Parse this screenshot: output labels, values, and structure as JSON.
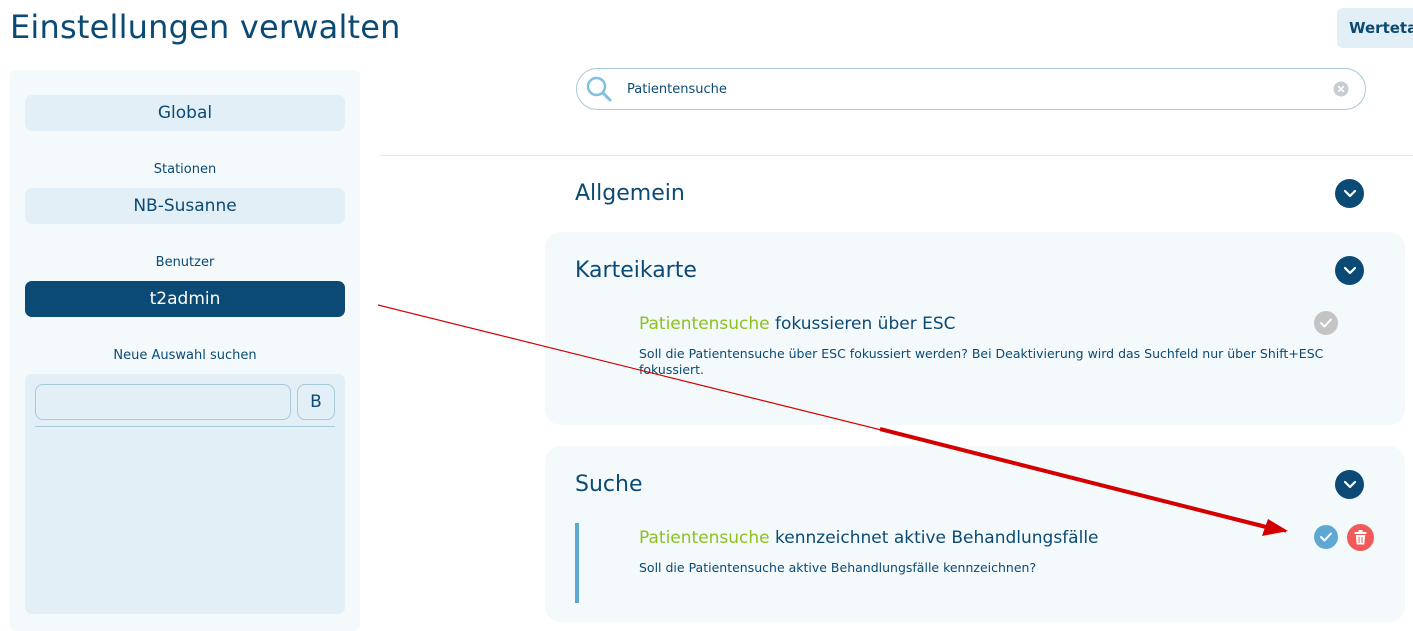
{
  "page": {
    "title": "Einstellungen verwalten",
    "top_right_button": "Wertetal"
  },
  "sidebar": {
    "global_button": "Global",
    "stationen_label": "Stationen",
    "station_button": "NB-Susanne",
    "benutzer_label": "Benutzer",
    "user_button": "t2admin",
    "neue_auswahl_label": "Neue Auswahl suchen",
    "search_input_value": "",
    "search_button": "B"
  },
  "search": {
    "value": "Patientensuche"
  },
  "sections": {
    "allgemein": {
      "title": "Allgemein"
    },
    "karteikarte": {
      "title": "Karteikarte",
      "setting": {
        "title_highlight": "Patientensuche",
        "title_rest": " fokussieren über ESC",
        "description": "Soll die Patientensuche über ESC fokussiert werden? Bei Deaktivierung wird das Suchfeld nur über Shift+ESC fokussiert."
      }
    },
    "suche": {
      "title": "Suche",
      "setting": {
        "title_highlight": "Patientensuche",
        "title_rest": " kennzeichnet aktive Behandlungsfälle",
        "description": "Soll die Patientensuche aktive Behandlungsfälle kennzeichnen?"
      }
    }
  },
  "colors": {
    "primary": "#0b4a74",
    "highlight": "#8cc11f",
    "panel": "#f4f9fb",
    "button_bg": "#e3eff6",
    "check_active": "#5fa8d3",
    "check_inactive": "#c4c4c4",
    "delete": "#f25a5a",
    "annotation_arrow": "#d40000"
  },
  "icons": [
    "search-icon",
    "clear-icon",
    "chevron-down-icon",
    "check-icon",
    "trash-icon"
  ]
}
